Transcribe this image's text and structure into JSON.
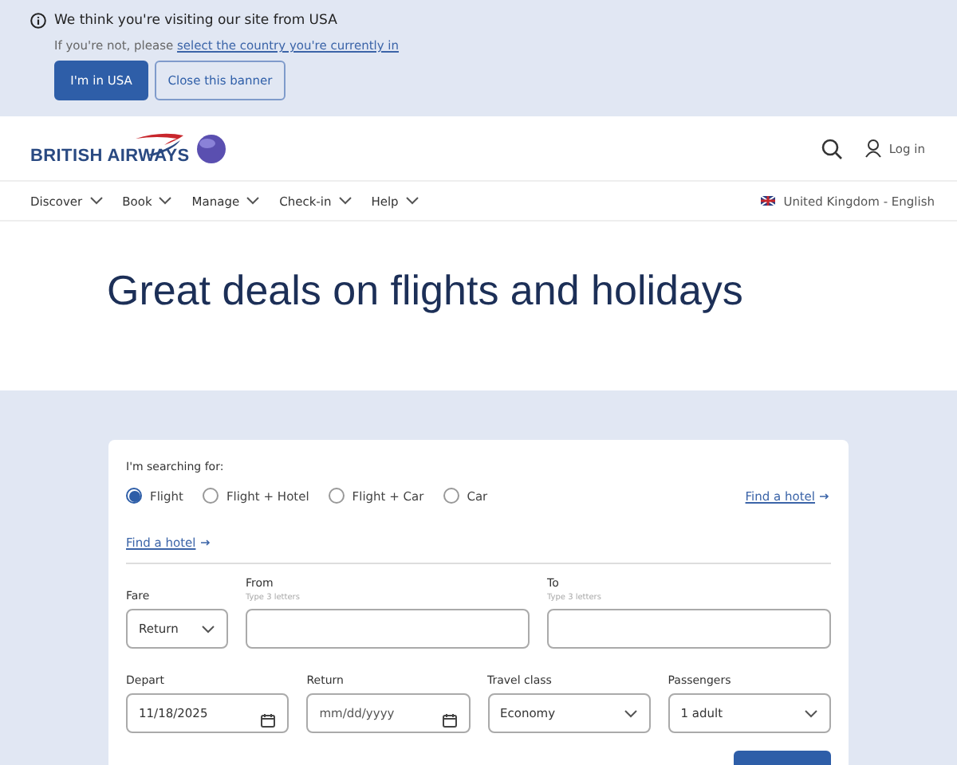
{
  "banner": {
    "message": "We think you're visiting our site from USA",
    "prompt": "If you're not, please",
    "link": "select the country you're currently in",
    "buttons": [
      "I'm in USA",
      "Close this banner"
    ]
  },
  "header": {
    "logo": "BRITISH AIRWAYS",
    "login": "Log in"
  },
  "nav": {
    "items": [
      "Discover",
      "Book",
      "Manage",
      "Check-in",
      "Help"
    ],
    "locale": "United Kingdom - English"
  },
  "hero": {
    "title": "Great deals on flights and holidays"
  },
  "search": {
    "label": "I'm searching for:",
    "options": [
      {
        "label": "Flight",
        "selected": true
      },
      {
        "label": "Flight + Hotel",
        "selected": false
      },
      {
        "label": "Flight + Car",
        "selected": false
      },
      {
        "label": "Car",
        "selected": false
      }
    ],
    "hotel_link_right": "Find a hotel",
    "hotel_link_left": "Find a hotel",
    "fare": {
      "label": "Fare",
      "value": "Return"
    },
    "from": {
      "label": "From",
      "hint": "Type 3 letters"
    },
    "to": {
      "label": "To",
      "hint": "Type 3 letters"
    },
    "depart": {
      "label": "Depart",
      "value": "11/18/2025"
    },
    "return": {
      "label": "Return",
      "placeholder": "mm/dd/yyyy"
    },
    "travel_class": {
      "label": "Travel class",
      "value": "Economy"
    },
    "passengers": {
      "label": "Passengers",
      "value": "1 adult"
    }
  }
}
